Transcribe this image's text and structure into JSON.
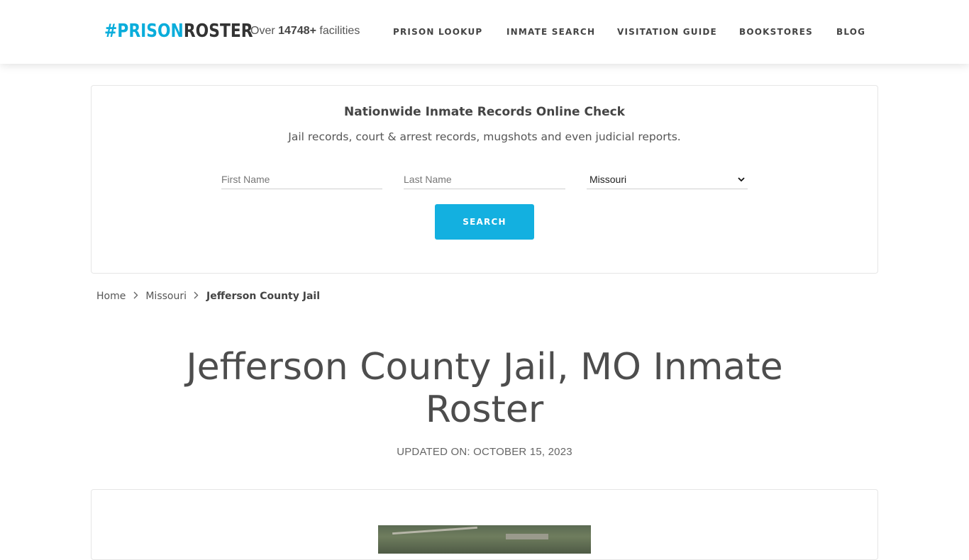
{
  "header": {
    "logo": {
      "hash": "#",
      "prison": "PRISON",
      "roster": "ROSTER"
    },
    "facilities": {
      "prefix": "Over",
      "count": "14748+",
      "suffix": "facilities"
    },
    "nav": [
      {
        "label": "PRISON LOOKUP"
      },
      {
        "label": "INMATE SEARCH"
      },
      {
        "label": "VISITATION GUIDE"
      },
      {
        "label": "BOOKSTORES"
      },
      {
        "label": "BLOG"
      }
    ]
  },
  "search": {
    "title": "Nationwide Inmate Records Online Check",
    "subtitle": "Jail records, court & arrest records, mugshots and even judicial reports.",
    "first_name_placeholder": "First Name",
    "last_name_placeholder": "Last Name",
    "state_selected": "Missouri",
    "button_label": "SEARCH"
  },
  "breadcrumb": {
    "home": "Home",
    "state": "Missouri",
    "current": "Jefferson County Jail"
  },
  "page": {
    "title": "Jefferson County Jail, MO Inmate Roster",
    "updated": "UPDATED ON: OCTOBER 15, 2023"
  },
  "colors": {
    "accent": "#13b0e0",
    "logo_blue": "#0aaddb",
    "text": "#4a4a4a"
  },
  "icons": {
    "breadcrumb_separator": "chevron-right-icon",
    "select_arrow": "chevron-down-icon"
  }
}
